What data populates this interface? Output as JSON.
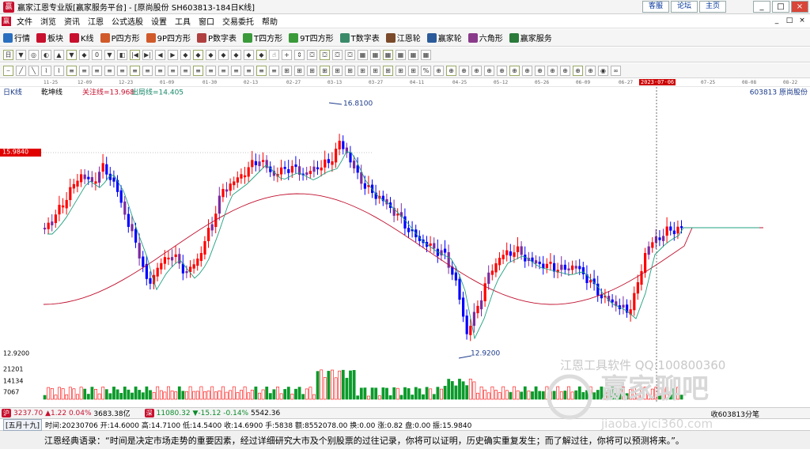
{
  "app": {
    "logo": "赢",
    "window_title": "赢家江恩专业版[赢家服务平台] - [原尚股份 SH603813-184日K线]",
    "top_links": [
      "客服",
      "论坛",
      "主页"
    ],
    "window_buttons": [
      "_",
      "□",
      "×"
    ]
  },
  "menu": {
    "icon": "赢",
    "items": [
      "文件",
      "浏览",
      "资讯",
      "江恩",
      "公式选股",
      "设置",
      "工具",
      "窗口",
      "交易委托",
      "帮助"
    ],
    "right_controls": [
      "_",
      "□",
      "×"
    ]
  },
  "toolbar1": [
    {
      "label": "行情",
      "icon": "grid-icon",
      "color": "#2a6fbf"
    },
    {
      "label": "板块",
      "icon": "blocks-icon",
      "color": "#c8102e"
    },
    {
      "label": "K线",
      "icon": "kline-icon",
      "color": "#c8102e"
    },
    {
      "label": "P四方形",
      "icon": "p-square-icon",
      "color": "#d05a2a"
    },
    {
      "label": "9P四方形",
      "icon": "9p-square-icon",
      "color": "#d05a2a"
    },
    {
      "label": "P数字表",
      "icon": "p-table-icon",
      "color": "#b04040"
    },
    {
      "label": "T四方形",
      "icon": "t-square-icon",
      "color": "#3a9a3a"
    },
    {
      "label": "9T四方形",
      "icon": "9t-square-icon",
      "color": "#3a9a3a"
    },
    {
      "label": "T数字表",
      "icon": "t-table-icon",
      "color": "#3a8a6a"
    },
    {
      "label": "江恩轮",
      "icon": "gann-wheel-icon",
      "color": "#7a4a2a"
    },
    {
      "label": "赢家轮",
      "icon": "winner-wheel-icon",
      "color": "#2a5a9a"
    },
    {
      "label": "六角形",
      "icon": "hexagon-icon",
      "color": "#8a3a8a"
    },
    {
      "label": "赢家服务",
      "icon": "service-icon",
      "color": "#2a7a3a"
    }
  ],
  "toolbar2_icons": [
    "日",
    "▼",
    "◎",
    "◐",
    "▲",
    "▼",
    "◆",
    "0",
    "▼",
    "◧",
    "|◀",
    "▶|",
    "◀",
    "▶",
    "◆",
    "◆",
    "◆",
    "◆",
    "◆",
    "◆",
    "◆",
    "☝",
    "+",
    "⇕",
    "⛋",
    "⛋",
    "⛋",
    "⛋",
    "▦",
    "▦",
    "▦",
    "▦",
    "▦",
    "▦"
  ],
  "toolbar3_icons": [
    "⎯",
    "╱",
    "╲",
    "⌇",
    "⌇",
    "≡",
    "≡",
    "≡",
    "≡",
    "≡",
    "≡",
    "≡",
    "≡",
    "≡",
    "≡",
    "≡",
    "≡",
    "≡",
    "≡",
    "≡",
    "≡",
    "≡",
    "⊞",
    "⊞",
    "⊞",
    "⊞",
    "⊞",
    "⊞",
    "⊞",
    "⊞",
    "⊞",
    "⊞",
    "⊞",
    "%",
    "⊕",
    "⊕",
    "⊕",
    "⊕",
    "⊕",
    "⊕",
    "⊕",
    "⊕",
    "⊕",
    "⊕",
    "⊕",
    "⊕",
    "⊕",
    "◉",
    "∞"
  ],
  "time_axis": {
    "ticks": [
      "11-25",
      "12-09",
      "12-23",
      "01-09",
      "01-30",
      "02-13",
      "02-27",
      "03-13",
      "03-27",
      "04-11",
      "04-25",
      "05-12",
      "05-26",
      "06-09",
      "06-27",
      "07-25",
      "08-08",
      "08-22"
    ],
    "selected": "2023-07-06"
  },
  "chart": {
    "period_label": "日K线",
    "indicator_name": "乾坤线",
    "focus_line_label": "关注线=13.968",
    "exit_line_label": "出局线=14.405",
    "stock_label": "603813  原尚股份",
    "current_price_tag": "15.9840",
    "high_label": "16.8100",
    "low_label": "12.9200",
    "price_axis_low": "12.9200",
    "volume_labels": [
      "21201",
      "14134",
      "7067"
    ],
    "candle_up_color": "#ff0000",
    "candle_down_color": "#0000ff",
    "candle_purple_color": "#7a2aa0",
    "ma_red_color": "#c0102e",
    "ma_green_color": "#20a080"
  },
  "status_bar": {
    "sh_badge": "沪",
    "sh_index": "3237.70",
    "sh_change": "▲1.22",
    "sh_pct": "0.04%",
    "sh_amount": "3683.38亿",
    "sz_badge": "深",
    "sz_index": "11080.32",
    "sz_change": "▼-15.12",
    "sz_pct": "-0.14%",
    "sz_amount": "5542.36",
    "right_text": "收603813分笔"
  },
  "info_bar": {
    "lunar": "[五月十九]",
    "text": "时间:20230706 开:14.6000 高:14.7100 低:14.5400 收:14.6900 手:5838 额:8552078.00 换:0.00 涨:0.82 盘:0.00 振:15.9840"
  },
  "quote": {
    "text": "江恩经典语录：“时间是决定市场走势的重要因素，经过详细研究大市及个别股票的过往记录，你将可以证明，历史确实重复发生；而了解过往，你将可以预测将来。”。"
  },
  "watermark": {
    "line1": "江恩工具软件  QQ:100800360",
    "line2": "赢家聊吧",
    "line3": "jiaoba.yici360.com"
  }
}
